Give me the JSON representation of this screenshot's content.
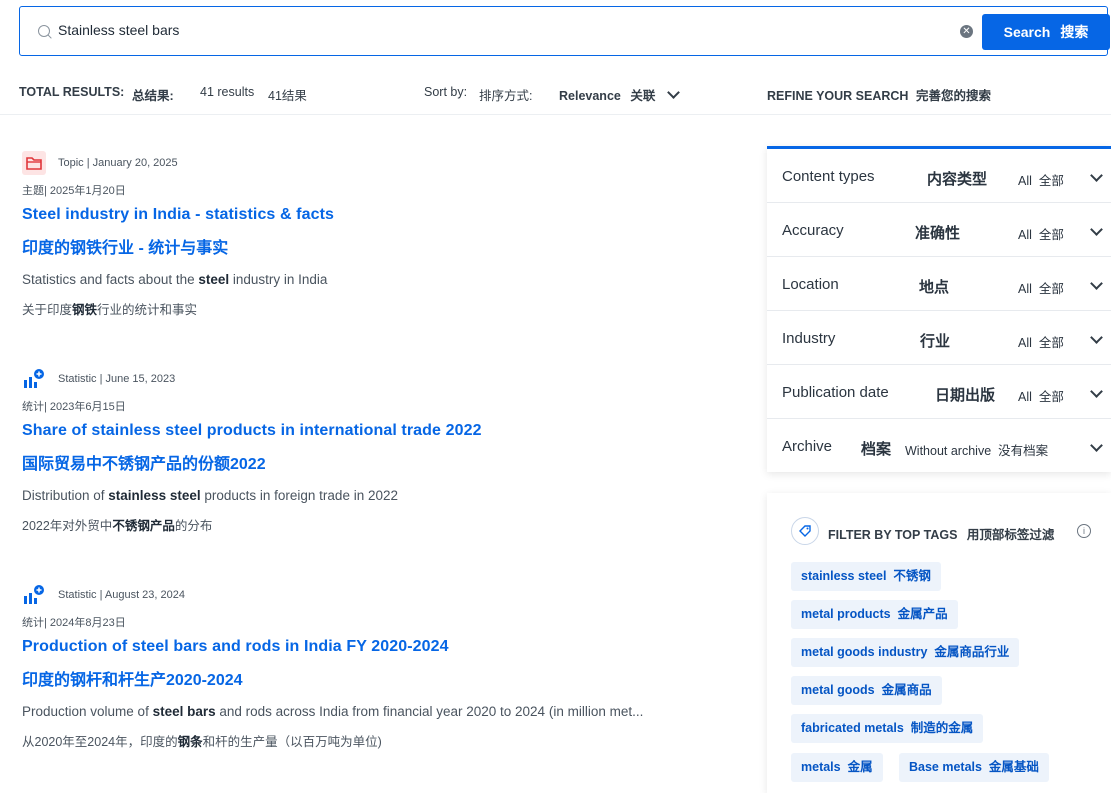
{
  "search": {
    "query": "Stainless steel bars",
    "button_label": "Search",
    "button_label_cn": "搜索"
  },
  "results_bar": {
    "total_label": "TOTAL RESULTS:",
    "total_label_cn": "总结果:",
    "count": "41 results",
    "count_cn": "41结果",
    "sort_label": "Sort by:",
    "sort_label_cn": "排序方式:",
    "sort_value": "Relevance",
    "sort_value_cn": "关联"
  },
  "refine": {
    "title": "REFINE YOUR SEARCH",
    "title_cn": "完善您的搜索"
  },
  "results": [
    {
      "type": "Topic",
      "meta": "Topic | January 20, 2025",
      "meta_cn": "主题| 2025年1月20日",
      "title": "Steel industry in India - statistics & facts",
      "title_cn": "印度的钢铁行业 - 统计与事实",
      "desc_pre": "Statistics and facts about the ",
      "desc_bold": "steel",
      "desc_post": " industry in India",
      "desc_cn_pre": "关于印度",
      "desc_cn_bold": "钢铁",
      "desc_cn_post": "行业的统计和事实"
    },
    {
      "type": "Statistic",
      "meta": "Statistic | June 15, 2023",
      "meta_cn": "统计| 2023年6月15日",
      "title": "Share of stainless steel products in international trade 2022",
      "title_cn": "国际贸易中不锈钢产品的份额2022",
      "desc_pre": "Distribution of ",
      "desc_bold": "stainless steel",
      "desc_post": " products in foreign trade in 2022",
      "desc_cn_pre": "2022年对外贸中",
      "desc_cn_bold": "不锈钢产品",
      "desc_cn_post": "的分布"
    },
    {
      "type": "Statistic",
      "meta": "Statistic | August 23, 2024",
      "meta_cn": "统计| 2024年8月23日",
      "title": "Production of steel bars and rods in India FY 2020-2024",
      "title_cn": "印度的钢杆和杆生产2020-2024",
      "desc_pre": "Production volume of ",
      "desc_bold": "steel bars",
      "desc_post": " and rods across India from financial year 2020 to 2024 (in million met...",
      "desc_cn_pre": "从2020年至2024年，印度的",
      "desc_cn_bold": "钢条",
      "desc_cn_post": "和杆的生产量（以百万吨为单位)"
    }
  ],
  "filters": [
    {
      "label": "Content types",
      "label_cn": "内容类型",
      "value": "All",
      "value_cn": "全部"
    },
    {
      "label": "Accuracy",
      "label_cn": "准确性",
      "value": "All",
      "value_cn": "全部"
    },
    {
      "label": "Location",
      "label_cn": "地点",
      "value": "All",
      "value_cn": "全部"
    },
    {
      "label": "Industry",
      "label_cn": "行业",
      "value": "All",
      "value_cn": "全部"
    },
    {
      "label": "Publication date",
      "label_cn": "日期出版",
      "value": "All",
      "value_cn": "全部"
    },
    {
      "label": "Archive",
      "label_cn": "档案",
      "value": "Without archive",
      "value_cn": "没有档案"
    }
  ],
  "tags_header": {
    "title": "FILTER BY TOP TAGS",
    "title_cn": "用顶部标签过滤"
  },
  "tags": [
    {
      "en": "stainless steel",
      "cn": "不锈钢"
    },
    {
      "en": "metal products",
      "cn": "金属产品"
    },
    {
      "en": "metal goods industry",
      "cn": "金属商品行业"
    },
    {
      "en": "metal goods",
      "cn": "金属商品"
    },
    {
      "en": "fabricated metals",
      "cn": "制造的金属"
    },
    {
      "en": "metals",
      "cn": "金属"
    },
    {
      "en": "Base metals",
      "cn": "金属基础"
    }
  ],
  "icons": {
    "topic": "folder-icon",
    "statistic": "chart-plus-icon",
    "accent": "#0666e5",
    "topic_icon_color": "#e0363b"
  }
}
